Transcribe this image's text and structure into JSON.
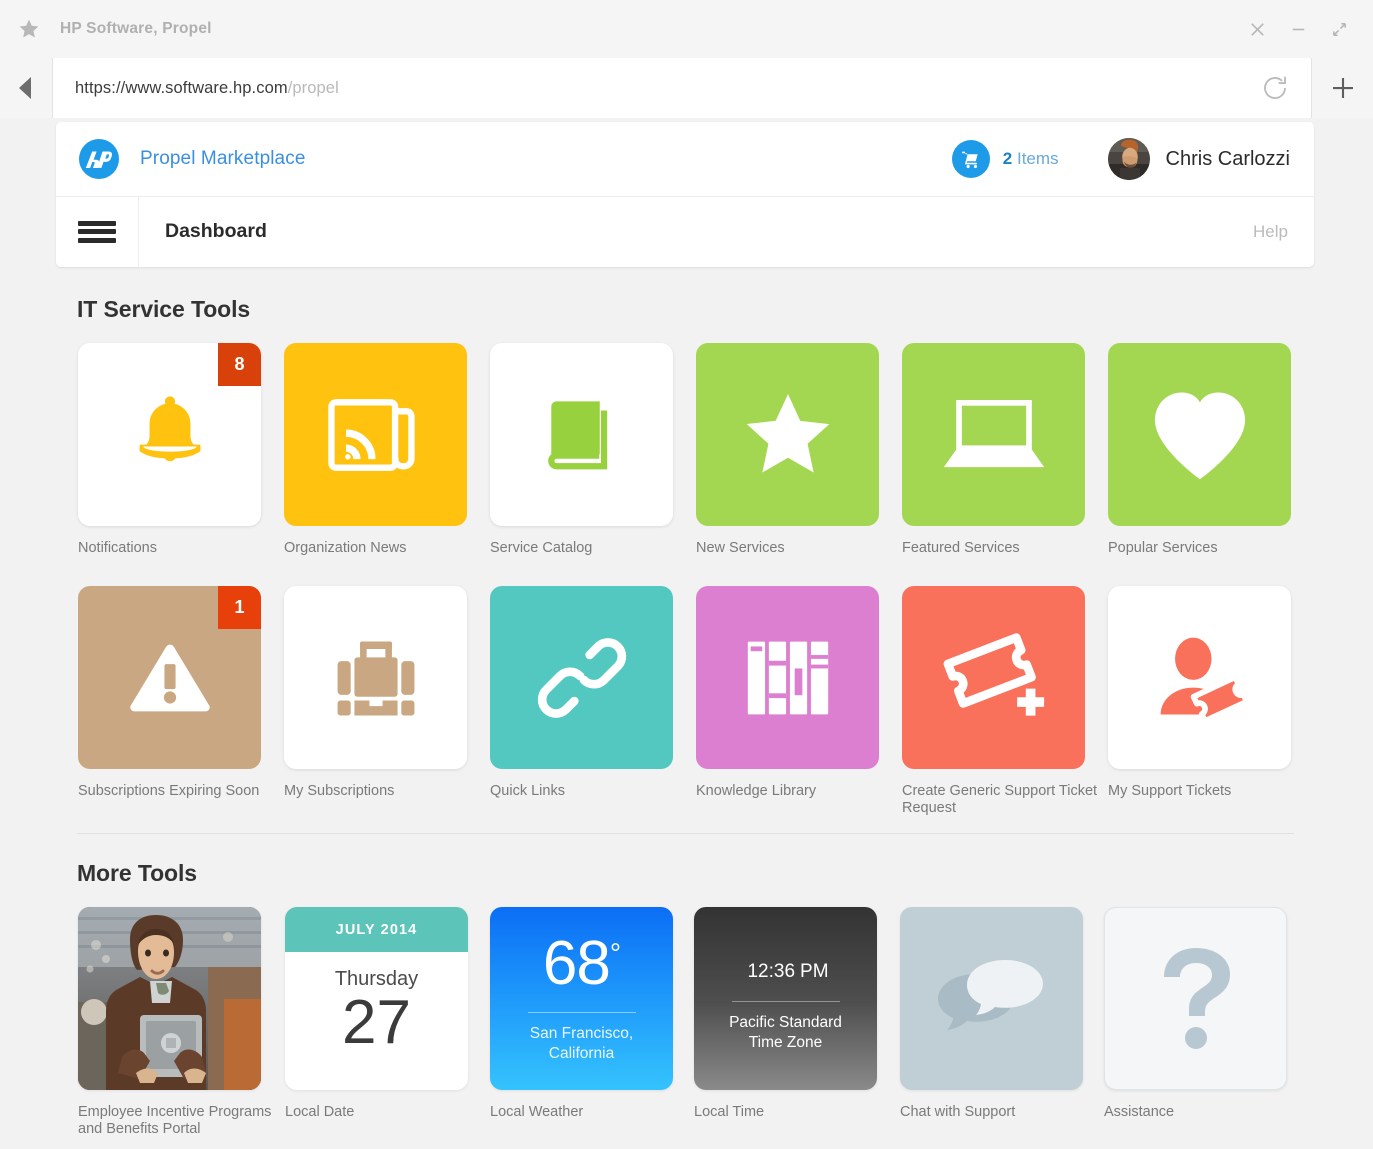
{
  "browser": {
    "tab_title": "HP Software, Propel",
    "url_base": "https://www.software.hp.com",
    "url_path": "/propel",
    "star_icon": "star-icon",
    "back_icon": "back-arrow-icon",
    "reload_icon": "reload-icon",
    "newtab_icon": "plus-icon",
    "close_icon": "close-icon",
    "minimize_icon": "minimize-icon",
    "expand_icon": "expand-icon"
  },
  "app_header": {
    "logo": "hp-logo",
    "brand": "Propel Marketplace",
    "cart_icon": "shopping-cart-icon",
    "cart_count": "2",
    "cart_word": "Items",
    "user_name": "Chris Carlozzi",
    "avatar": "user-avatar",
    "menu_icon": "hamburger-menu-icon",
    "page_title": "Dashboard",
    "help_label": "Help",
    "accent_blue": "#1d9ae8",
    "brand_blue": "#3a8fe0"
  },
  "sections": {
    "it_service_tools": {
      "title": "IT Service Tools",
      "tiles": [
        {
          "label": "Notifications",
          "icon": "bell-icon",
          "bg": "#ffffff",
          "fg": "#ffc20e",
          "badge": "8",
          "badge_bg": "#d9410a"
        },
        {
          "label": "Organization News",
          "icon": "news-rss-icon",
          "bg": "#ffc20e",
          "fg": "#ffffff",
          "badge": null,
          "badge_bg": null
        },
        {
          "label": "Service Catalog",
          "icon": "book-icon",
          "bg": "#ffffff",
          "fg": "#97d13e",
          "badge": null,
          "badge_bg": null
        },
        {
          "label": "New Services",
          "icon": "star-icon",
          "bg": "#a4d751",
          "fg": "#ffffff",
          "badge": null,
          "badge_bg": null
        },
        {
          "label": "Featured Services",
          "icon": "laptop-icon",
          "bg": "#a4d751",
          "fg": "#ffffff",
          "badge": null,
          "badge_bg": null
        },
        {
          "label": "Popular Services",
          "icon": "heart-icon",
          "bg": "#a4d751",
          "fg": "#ffffff",
          "badge": null,
          "badge_bg": null
        },
        {
          "label": "Subscriptions Expiring Soon",
          "icon": "warning-triangle-icon",
          "bg": "#c9a782",
          "fg": "#ffffff",
          "badge": "1",
          "badge_bg": "#e8400a"
        },
        {
          "label": "My Subscriptions",
          "icon": "briefcase-icon",
          "bg": "#ffffff",
          "fg": "#c9a782",
          "badge": null,
          "badge_bg": null
        },
        {
          "label": "Quick Links",
          "icon": "link-chain-icon",
          "bg": "#53c8c0",
          "fg": "#ffffff",
          "badge": null,
          "badge_bg": null
        },
        {
          "label": "Knowledge Library",
          "icon": "books-shelf-icon",
          "bg": "#dd7fd0",
          "fg": "#ffffff",
          "badge": null,
          "badge_bg": null
        },
        {
          "label": "Create Generic Support Ticket Request",
          "icon": "ticket-plus-icon",
          "bg": "#f9705b",
          "fg": "#ffffff",
          "badge": null,
          "badge_bg": null
        },
        {
          "label": "My Support Tickets",
          "icon": "user-ticket-icon",
          "bg": "#ffffff",
          "fg": "#f9705b",
          "badge": null,
          "badge_bg": null
        }
      ]
    },
    "more_tools": {
      "title": "More Tools",
      "tiles": [
        {
          "label": "Employee Incentive Programs and Benefits Portal",
          "kind": "photo",
          "icon": "photo-person-tablet"
        },
        {
          "label": "Local Date",
          "kind": "calendar",
          "month_year": "JULY 2014",
          "weekday": "Thursday",
          "day": "27",
          "header_bg": "#5cc4b8"
        },
        {
          "label": "Local Weather",
          "kind": "weather",
          "temperature": "68",
          "degree": "°",
          "location_line1": "San Francisco,",
          "location_line2": "California"
        },
        {
          "label": "Local Time",
          "kind": "time",
          "time": "12:36",
          "meridiem": "PM",
          "zone_line1": "Pacific Standard",
          "zone_line2": "Time Zone"
        },
        {
          "label": "Chat with Support",
          "kind": "chat",
          "icon": "chat-bubbles-icon",
          "bg": "#c0cfd6"
        },
        {
          "label": "Assistance",
          "kind": "assistance",
          "icon": "question-mark-icon",
          "bg": "#f4f6f7"
        }
      ]
    }
  }
}
